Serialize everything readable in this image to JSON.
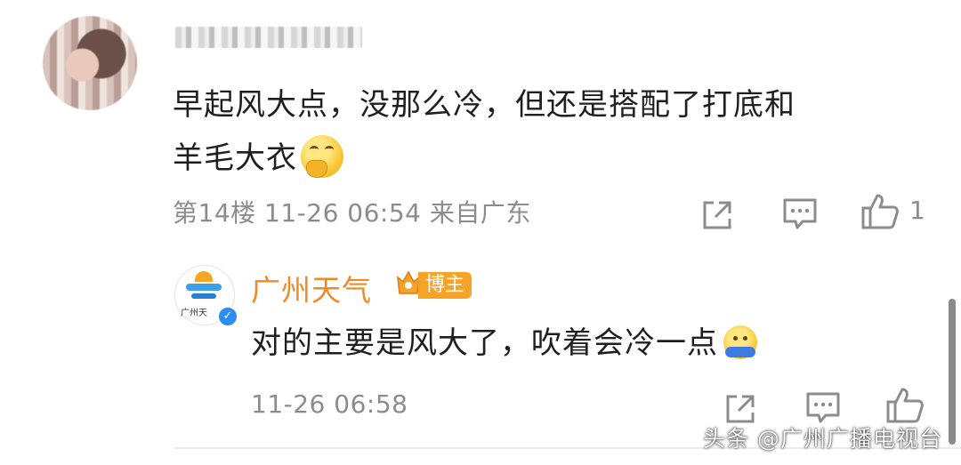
{
  "comment": {
    "text_line1": "早起风大点，没那么冷，但还是搭配了打底和",
    "text_line2": "羊毛大衣",
    "emoji": "thinking-face-emoji",
    "meta": "第14楼 11-26 06:54 来自广东",
    "like_count": "1"
  },
  "reply": {
    "author": "广州天气",
    "avatar_text": "广州天",
    "badge_label": "博主",
    "text": "对的主要是风大了，吹着会冷一点",
    "emoji": "cold-face-emoji",
    "time": "11-26 06:58"
  },
  "watermark": "头条 @广州广播电视台",
  "colors": {
    "author_orange": "#f08a24",
    "badge_orange": "#f7a326",
    "meta_gray": "#8c8c8c",
    "verified_blue": "#2d8cf0"
  }
}
